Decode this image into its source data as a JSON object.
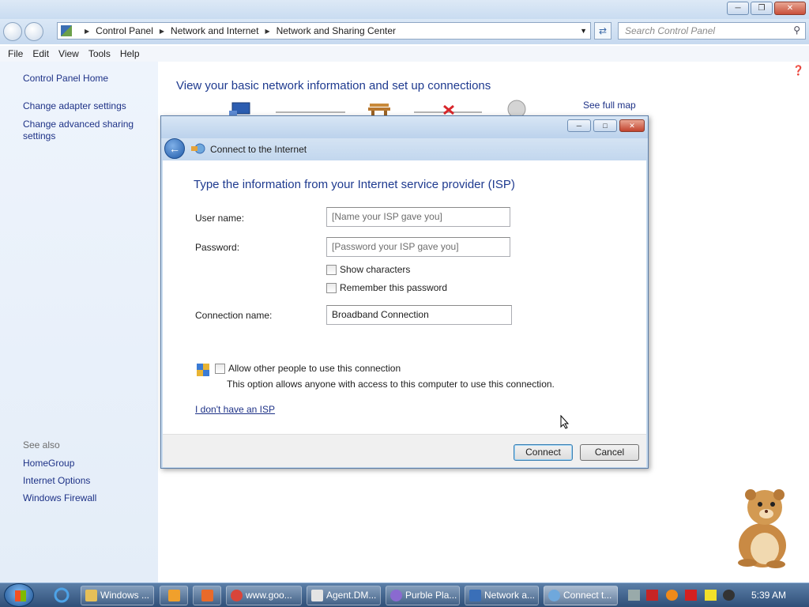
{
  "explorer": {
    "breadcrumb": [
      "Control Panel",
      "Network and Internet",
      "Network and Sharing Center"
    ],
    "search_placeholder": "Search Control Panel",
    "menu": [
      "File",
      "Edit",
      "View",
      "Tools",
      "Help"
    ]
  },
  "leftpane": {
    "home": "Control Panel Home",
    "links": [
      "Change adapter settings",
      "Change advanced sharing settings"
    ],
    "see_also_label": "See also",
    "see_also": [
      "HomeGroup",
      "Internet Options",
      "Windows Firewall"
    ]
  },
  "main": {
    "title": "View your basic network information and set up connections",
    "full_map": "See full map"
  },
  "dialog": {
    "title": "Connect to the Internet",
    "heading": "Type the information from your Internet service provider (ISP)",
    "username_label": "User name:",
    "username_placeholder": "[Name your ISP gave you]",
    "password_label": "Password:",
    "password_placeholder": "[Password your ISP gave you]",
    "show_characters": "Show characters",
    "remember_password": "Remember this password",
    "connection_name_label": "Connection name:",
    "connection_name_value": "Broadband Connection",
    "allow_others": "Allow other people to use this connection",
    "allow_desc": "This option allows anyone with access to this computer to use this connection.",
    "no_isp_link": "I don't have an ISP",
    "connect": "Connect",
    "cancel": "Cancel"
  },
  "taskbar": {
    "tasks": [
      "Windows ...",
      "www.goo...",
      "Agent.DM...",
      "Purble Pla...",
      "Network a...",
      "Connect t..."
    ],
    "clock": "5:39 AM"
  },
  "colors": {
    "link": "#1e3287",
    "heading": "#1e3a8f",
    "leftpane_bg": "#eef4fc",
    "taskbar": "#2f4f78"
  }
}
